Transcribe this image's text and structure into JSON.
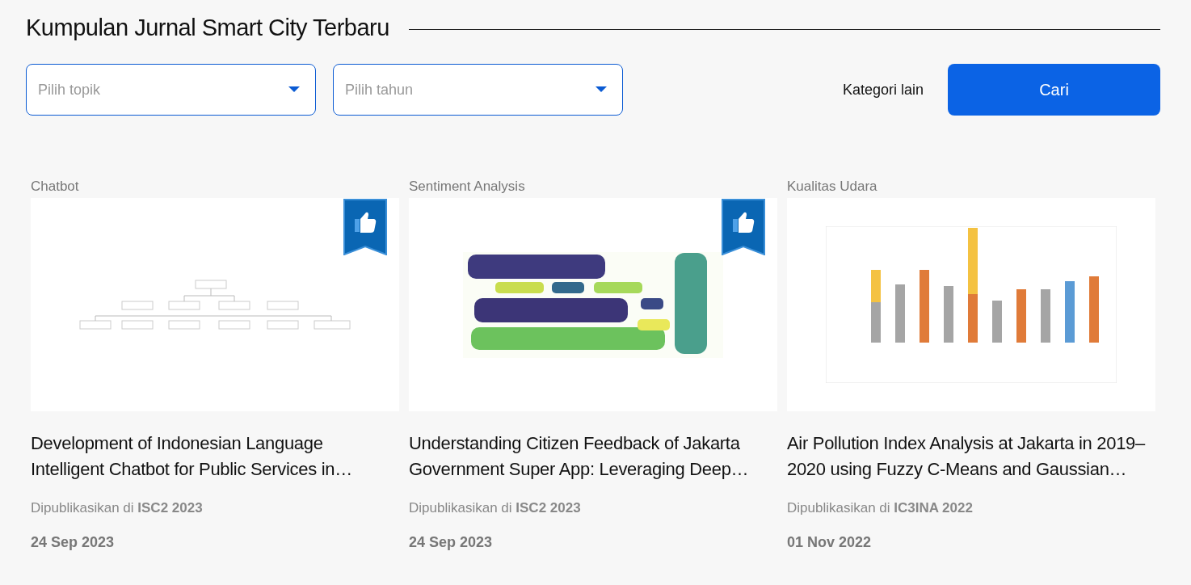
{
  "title": "Kumpulan Jurnal Smart City Terbaru",
  "filters": [
    {
      "placeholder": "Pilih topik"
    },
    {
      "placeholder": "Pilih tahun"
    }
  ],
  "other_link": "Kategori lain",
  "search_button": "Cari",
  "cards": [
    {
      "category": "Chatbot",
      "featured": true,
      "thumbnail": {
        "kind": "diagram"
      },
      "title": "Development of Indonesian Language Intelligent Chatbot for Public Services in…",
      "published": "Dipublikasikan di **ISC2 2023**",
      "date": "24 Sep 2023"
    },
    {
      "category": "Sentiment Analysis",
      "featured": true,
      "thumbnail": {
        "kind": "cloud"
      },
      "title": "Understanding Citizen Feedback of Jakarta Government Super App: Leveraging Deep…",
      "published": "Dipublikasikan di **ISC2 2023**",
      "date": "24 Sep 2023"
    },
    {
      "category": "Kualitas Udara",
      "featured": false,
      "thumbnail": {
        "kind": "bars"
      },
      "title": "Air Pollution Index Analysis at Jakarta in 2019–2020 using Fuzzy C-Means and Gaussian…",
      "published": "Dipublikasikan di **IC3INA 2022**",
      "date": "01 Nov 2022"
    }
  ]
}
